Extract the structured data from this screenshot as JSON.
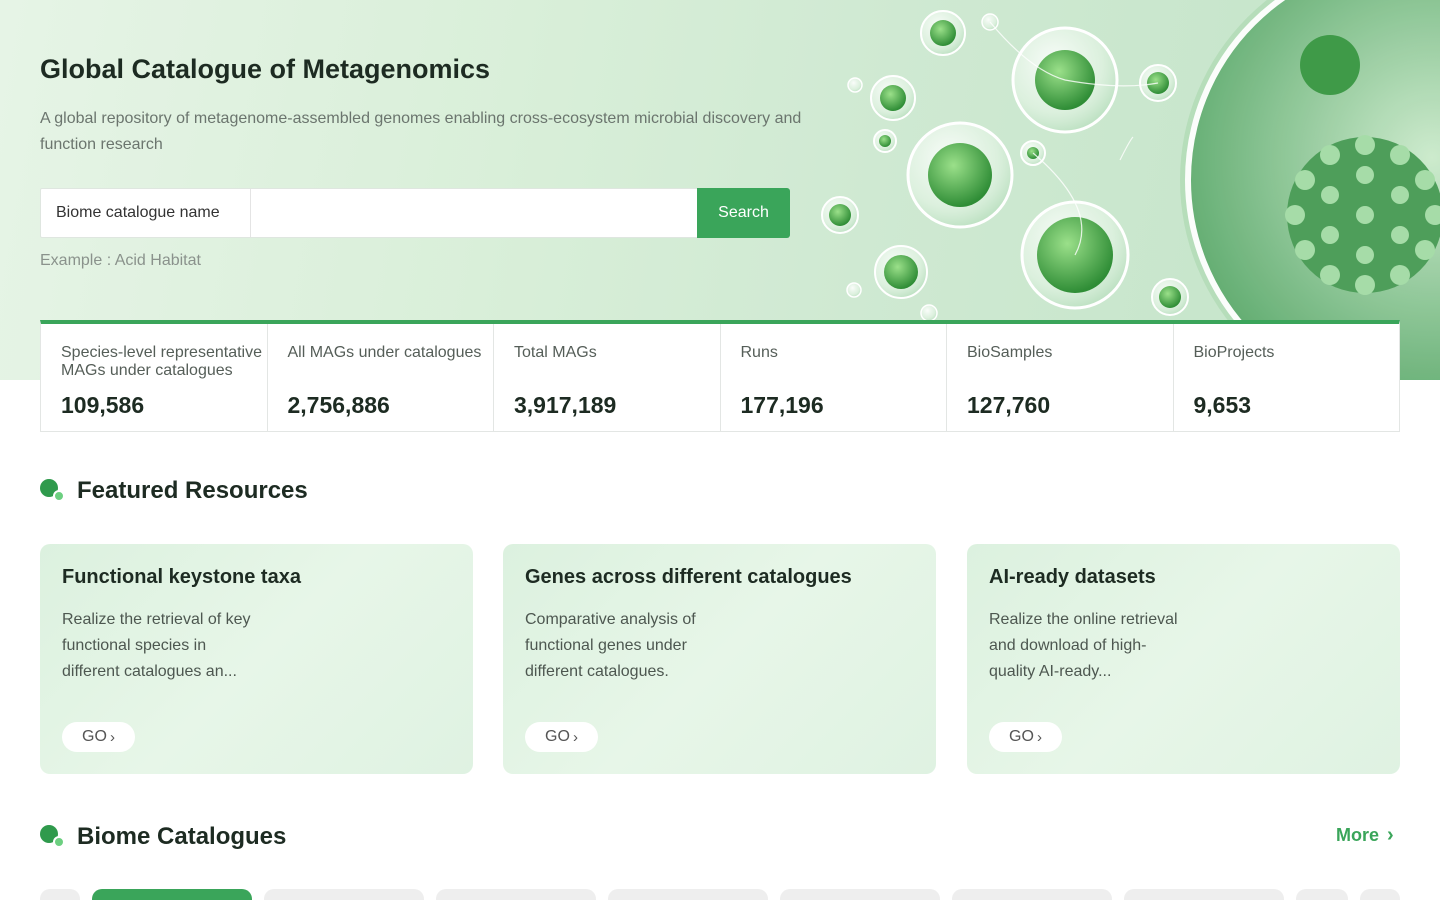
{
  "hero": {
    "title": "Global Catalogue of Metagenomics",
    "subtitle": "A global repository of metagenome-assembled genomes enabling cross-ecosystem microbial discovery and function research"
  },
  "search": {
    "select_value": "Biome catalogue name",
    "input_value": "",
    "button_label": "Search",
    "example_text": "Example : Acid Habitat"
  },
  "stats": [
    {
      "label": "Species-level representative MAGs under catalogues",
      "value": "109,586"
    },
    {
      "label": "All MAGs under catalogues",
      "value": "2,756,886"
    },
    {
      "label": "Total MAGs",
      "value": "3,917,189"
    },
    {
      "label": "Runs",
      "value": "177,196"
    },
    {
      "label": "BioSamples",
      "value": "127,760"
    },
    {
      "label": "BioProjects",
      "value": "9,653"
    }
  ],
  "featured": {
    "heading": "Featured Resources",
    "cards": [
      {
        "title": "Functional keystone taxa",
        "description": "Realize the retrieval of key functional species in different catalogues an...",
        "button": "GO"
      },
      {
        "title": "Genes across different catalogues",
        "description": "Comparative analysis of functional genes under different catalogues.",
        "button": "GO"
      },
      {
        "title": "AI-ready datasets",
        "description": "Realize the online retrieval and download of high-quality AI-ready...",
        "button": "GO"
      }
    ]
  },
  "biome": {
    "heading": "Biome Catalogues",
    "more_label": "More"
  },
  "colors": {
    "accent": "#3aa55a",
    "hero_bg": "#d9efd9",
    "card_bg": "#e2f4e4"
  }
}
